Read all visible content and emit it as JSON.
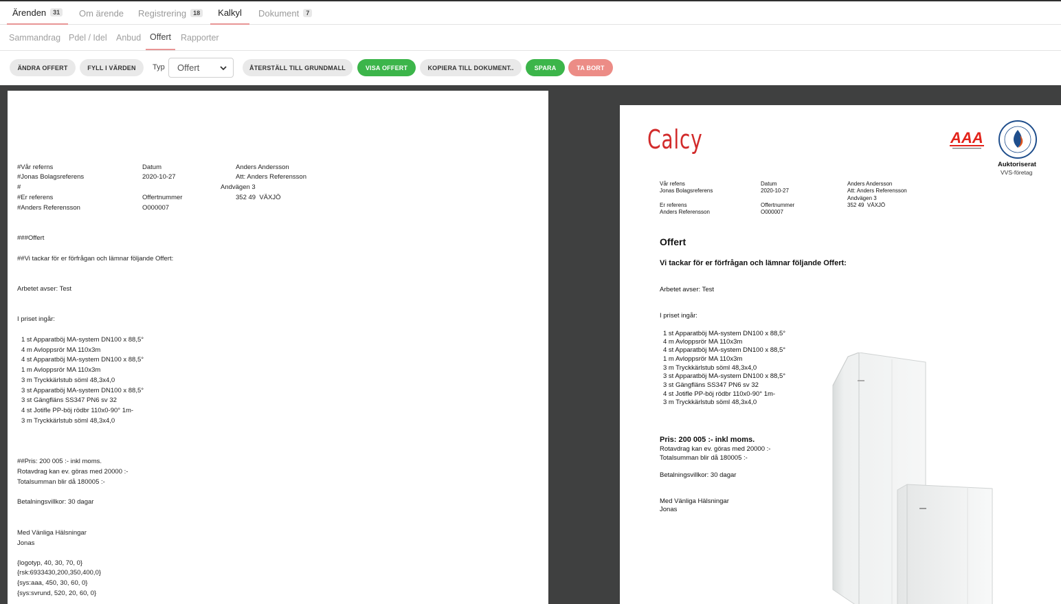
{
  "top_tabs": [
    {
      "label": "Ärenden",
      "badge": "31"
    },
    {
      "label": "Om ärende",
      "badge": ""
    },
    {
      "label": "Registrering",
      "badge": "18"
    },
    {
      "label": "Kalkyl",
      "badge": ""
    },
    {
      "label": "Dokument",
      "badge": "7"
    }
  ],
  "sub_tabs": [
    "Sammandrag",
    "Pdel / Idel",
    "Anbud",
    "Offert",
    "Rapporter"
  ],
  "toolbar": {
    "andra_offert": "ÄNDRA OFFERT",
    "fyll_i_varden": "FYLL I VÄRDEN",
    "typ_label": "Typ",
    "typ_value": "Offert",
    "aterstall": "ÅTERSTÄLL TILL GRUNDMALL",
    "visa_offert": "VISA OFFERT",
    "kopiera": "KOPIERA TILL DOKUMENT..",
    "spara": "SPARA",
    "ta_bort": "TA BORT"
  },
  "editor": {
    "header_left": [
      "#Vår referns",
      "#Jonas Bolagsreferens",
      "#",
      "#Er referens",
      "#Anders Referensson"
    ],
    "header_mid": [
      "Datum",
      "2020-10-27",
      "",
      "Offertnummer",
      "O000007"
    ],
    "header_right": [
      "Anders Andersson",
      "Att: Anders Referensson",
      "Andvägen 3",
      "352 49  VÄXJÖ"
    ],
    "heading": "###Offert",
    "subheading": "##Vi tackar för er förfrågan och lämnar följande Offert:",
    "arbetet": "Arbetet avser: Test",
    "i_priset": "I priset ingår:",
    "items": [
      "1 st Apparatböj MA-system DN100 x 88,5°",
      "4 m Avloppsrör MA 110x3m",
      "4 st Apparatböj MA-system DN100 x 88,5°",
      "1 m Avloppsrör MA 110x3m",
      "3 m Tryckkärlstub söml 48,3x4,0",
      "3 st Apparatböj MA-system DN100 x 88,5°",
      "3 st Gängfläns SS347 PN6 sv 32",
      "4 st Jotifle PP-böj rödbr 110x0-90° 1m-",
      "3 m Tryckkärlstub söml 48,3x4,0"
    ],
    "price": "##Pris: 200 005 :- inkl moms.",
    "rot": "Rotavdrag kan ev. göras med 20000 :-",
    "total": "Totalsumman blir då 180005 :-",
    "villkor": "Betalningsvillkor: 30 dagar",
    "halsning": "Med Vänliga Hälsningar",
    "namn": "Jonas",
    "codes": [
      "{logotyp, 40, 30, 70, 0}",
      "{rsk:6933430,200,350,400,0}",
      "{sys:aaa, 450, 30, 60, 0}",
      "{sys:svrund, 520, 20, 60, 0}"
    ]
  },
  "preview": {
    "logo": "Calcy",
    "aaa_logo": "AAA",
    "cert_title": "Auktoriserat",
    "cert_sub": "VVS-företag",
    "header_left": [
      "Vår refens",
      "Jonas Bolagsreferens",
      "",
      "Er referens",
      "Anders Referensson"
    ],
    "header_mid": [
      "Datum",
      "2020-10-27",
      "",
      "Offertnummer",
      "O000007"
    ],
    "header_right": [
      "Anders Andersson",
      "Att: Anders Referensson",
      "Andvägen 3",
      "352 49  VÄXJÖ"
    ],
    "heading": "Offert",
    "subheading": "Vi tackar för er förfrågan och lämnar följande Offert:",
    "arbetet": "Arbetet avser: Test",
    "i_priset": "I priset ingår:",
    "items": [
      "1 st Apparatböj MA-system DN100 x 88,5°",
      "4 m Avloppsrör MA 110x3m",
      "4 st Apparatböj MA-system DN100 x 88,5°",
      "1 m Avloppsrör MA 110x3m",
      "3 m Tryckkärlstub söml 48,3x4,0",
      "3 st Apparatböj MA-system DN100 x 88,5°",
      "3 st Gängfläns SS347 PN6 sv 32",
      "4 st Jotifle PP-böj rödbr 110x0-90° 1m-",
      "3 m Tryckkärlstub söml 48,3x4,0"
    ],
    "price": "Pris: 200 005 :- inkl moms.",
    "rot": "Rotavdrag kan ev. göras med 20000 :-",
    "total": "Totalsumman blir då 180005 :-",
    "villkor": "Betalningsvillkor: 30 dagar",
    "halsning": "Med Vänliga Hälsningar",
    "namn": "Jonas"
  }
}
